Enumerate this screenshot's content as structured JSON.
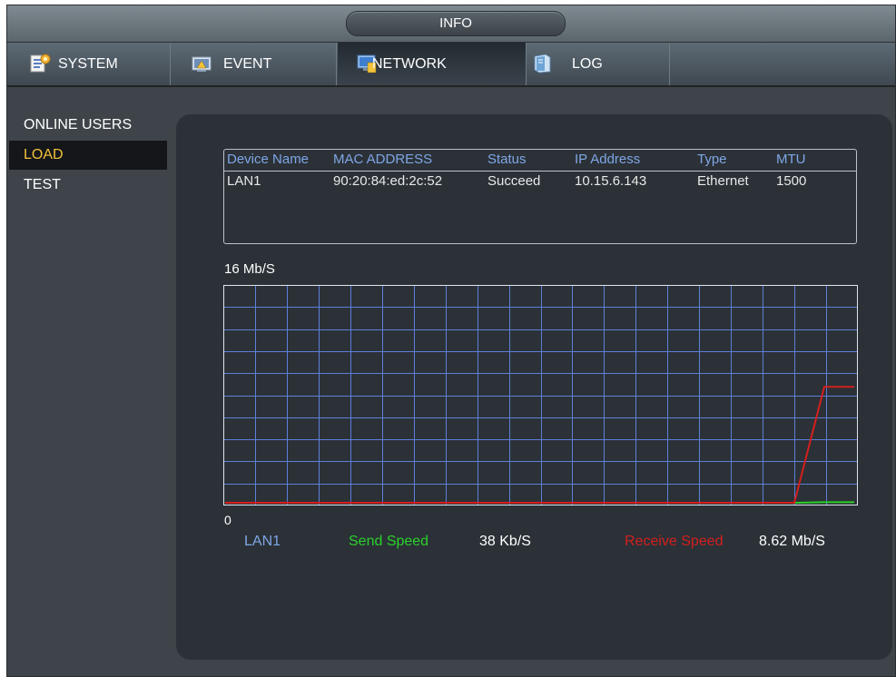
{
  "window": {
    "title": "INFO"
  },
  "tabs": [
    {
      "label": "SYSTEM",
      "icon": "system-icon"
    },
    {
      "label": "EVENT",
      "icon": "event-icon"
    },
    {
      "label": "NETWORK",
      "icon": "network-icon",
      "active": true
    },
    {
      "label": "LOG",
      "icon": "log-icon"
    }
  ],
  "sidebar": {
    "items": [
      {
        "label": "ONLINE USERS"
      },
      {
        "label": "LOAD",
        "active": true
      },
      {
        "label": "TEST"
      }
    ]
  },
  "device_table": {
    "headers": [
      "Device Name",
      "MAC ADDRESS",
      "Status",
      "IP Address",
      "Type",
      "MTU"
    ],
    "rows": [
      [
        "LAN1",
        "90:20:84:ed:2c:52",
        "Succeed",
        "10.15.6.143",
        "Ethernet",
        "1500"
      ]
    ]
  },
  "graph": {
    "scale_max": "16 Mb/S",
    "scale_min": "0",
    "legend_lan": "LAN1",
    "legend_send": "Send Speed",
    "send_value": "38 Kb/S",
    "legend_receive": "Receive Speed",
    "receive_value": "8.62 Mb/S"
  },
  "chart_data": {
    "type": "line",
    "ylim": [
      0,
      16
    ],
    "series": [
      {
        "name": "Send Speed",
        "color": "#2ad12a",
        "values": [
          0,
          0,
          0,
          0,
          0,
          0,
          0,
          0,
          0,
          0,
          0,
          0,
          0,
          0,
          0,
          0,
          0,
          0,
          0,
          0,
          0.04,
          0.04
        ]
      },
      {
        "name": "Receive Speed",
        "color": "#d41f1f",
        "values": [
          0,
          0,
          0,
          0,
          0,
          0,
          0,
          0,
          0,
          0,
          0,
          0,
          0,
          0,
          0,
          0,
          0,
          0,
          0,
          0,
          8.62,
          8.62
        ]
      }
    ]
  },
  "colors": {
    "accent_active": "#f2c23a",
    "grid": "#5e7fd9",
    "header_text": "#7fa6e6"
  }
}
